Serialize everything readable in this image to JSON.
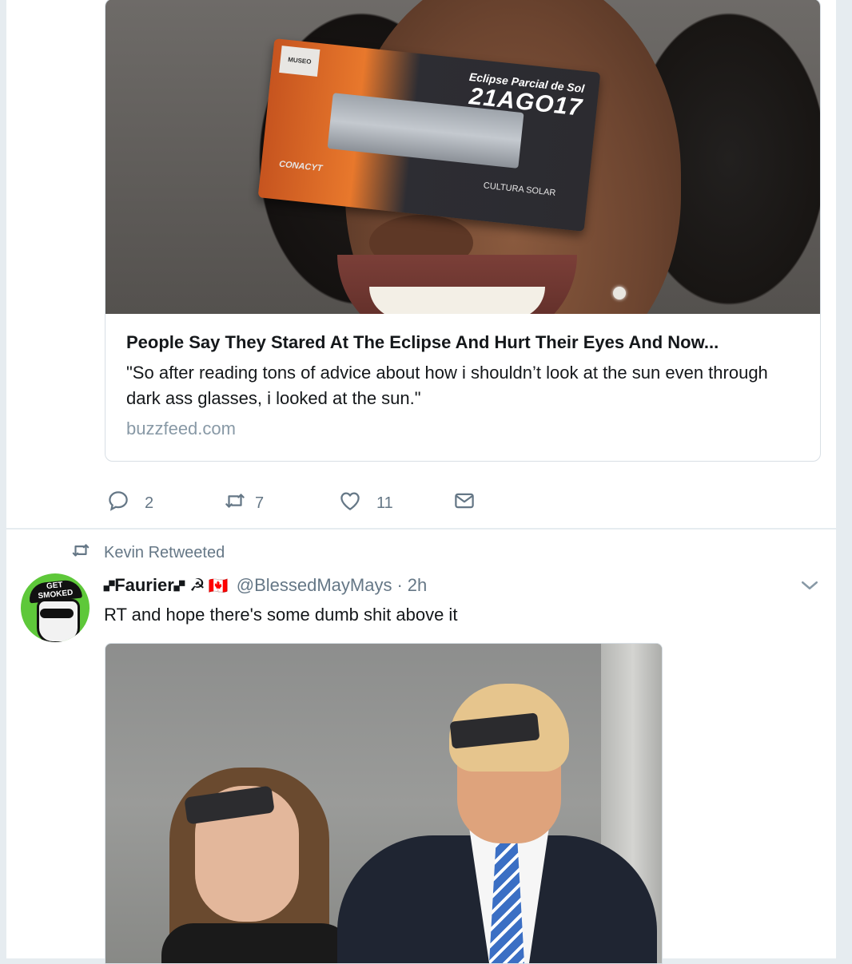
{
  "tweet1": {
    "card": {
      "image": {
        "sign_subtitle": "Eclipse Parcial de Sol",
        "sign_date": "21AGO17",
        "museum_tag": "MUSEO",
        "logo_left": "CONACYT",
        "logo_right": "CULTURA SOLAR"
      },
      "title": "People Say They Stared At The Eclipse And Hurt Their Eyes And Now...",
      "description": "\"So after reading tons of advice about how i shouldn’t look at the sun even through dark ass glasses, i looked at the sun.\"",
      "domain": "buzzfeed.com"
    },
    "actions": {
      "reply_count": "2",
      "retweet_count": "7",
      "like_count": "11"
    }
  },
  "tweet2": {
    "context": "Kevin Retweeted",
    "avatar_text": "GET SMOKED",
    "display_name": "🙾Faurier🙾 ☭",
    "flag": "🇨🇦",
    "screen_name": "@BlessedMayMays",
    "separator": "·",
    "time": "2h",
    "text": "RT and hope there's some dumb shit above it"
  },
  "colors": {
    "accent_gray": "#657786",
    "link_gray": "#8899a6",
    "border": "#e6ecf0"
  },
  "icons": [
    "reply-icon",
    "retweet-icon",
    "like-icon",
    "message-icon",
    "chevron-down-icon"
  ]
}
